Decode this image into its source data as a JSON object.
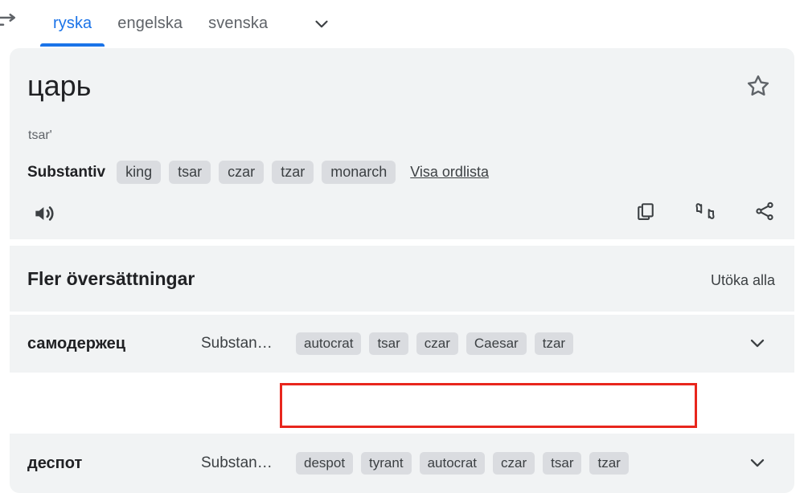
{
  "header": {
    "swap_icon": "swap-horizontal-icon",
    "tabs": [
      {
        "label": "ryska",
        "active": true
      },
      {
        "label": "engelska",
        "active": false
      },
      {
        "label": "svenska",
        "active": false
      }
    ],
    "more_languages_icon": "chevron-down-icon",
    "accent_color": "#1a73e8"
  },
  "entry": {
    "word": "царь",
    "transliteration": "tsar'",
    "part_of_speech": "Substantiv",
    "translations": [
      "king",
      "tsar",
      "czar",
      "tzar",
      "monarch"
    ],
    "wordlist_link": "Visa ordlista",
    "favorite_icon": "star-outline-icon",
    "speak_icon": "speaker-icon",
    "actions": [
      {
        "icon": "copy-icon"
      },
      {
        "icon": "thumbs-up-down-icon"
      },
      {
        "icon": "share-icon"
      }
    ]
  },
  "more_translations": {
    "title": "Fler översättningar",
    "expand_all": "Utöka alla",
    "rows": [
      {
        "word": "самодержец",
        "part_of_speech": "Substan…",
        "chips": [
          "autocrat",
          "tsar",
          "czar",
          "Caesar",
          "tzar"
        ],
        "expand_icon": "chevron-down-icon",
        "highlighted": false
      },
      {
        "word": "деспот",
        "part_of_speech": "Substan…",
        "chips": [
          "despot",
          "tyrant",
          "autocrat",
          "czar",
          "tsar",
          "tzar"
        ],
        "expand_icon": "chevron-down-icon",
        "highlighted": true
      }
    ]
  },
  "annotation": {
    "color": "#e8261d",
    "target": "деспот-translation-chips"
  },
  "colors": {
    "card_background": "#f1f3f4",
    "chip_background": "#dadce0",
    "page_background": "#ffffff",
    "text_primary": "#202124",
    "text_secondary": "#5f6368"
  }
}
